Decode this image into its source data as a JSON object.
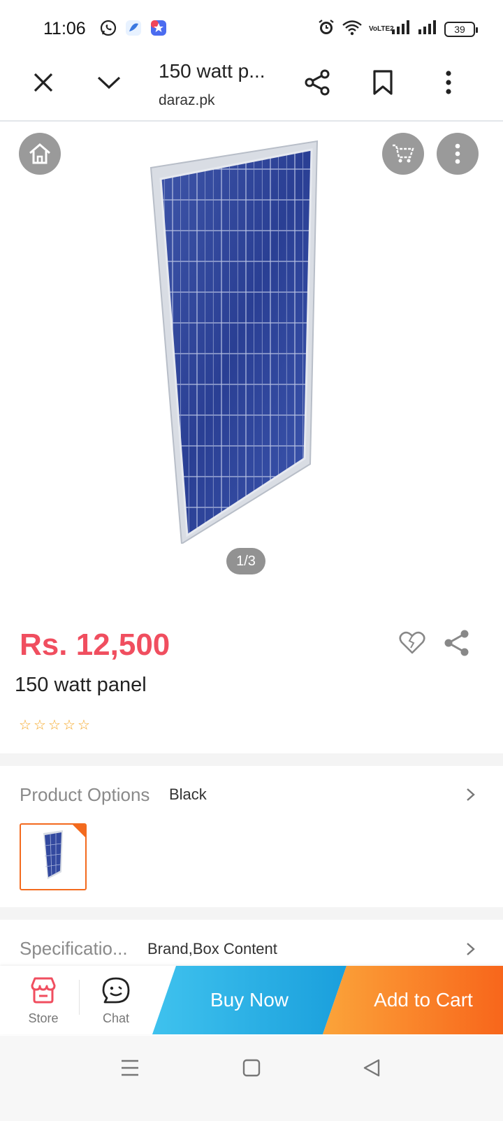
{
  "status_bar": {
    "time": "11:06",
    "battery": "39",
    "network_label": "VoLTE2"
  },
  "browser": {
    "title": "150 watt p...",
    "domain": "daraz.pk"
  },
  "gallery": {
    "counter": "1/3"
  },
  "product": {
    "price": "Rs. 12,500",
    "title": "150 watt panel",
    "rating_stars": 0,
    "max_stars": 5,
    "star_color": "#f5a623"
  },
  "options": {
    "label": "Product Options",
    "value": "Black"
  },
  "specs": {
    "label": "Specificatio...",
    "value": "Brand,Box Content"
  },
  "actions": {
    "store_label": "Store",
    "chat_label": "Chat",
    "buy_now_label": "Buy Now",
    "add_to_cart_label": "Add to Cart"
  },
  "colors": {
    "price": "#f04e5f",
    "buy_now": "#1a9fdc",
    "add_to_cart": "#f8661b",
    "store_icon": "#f04e5f"
  }
}
